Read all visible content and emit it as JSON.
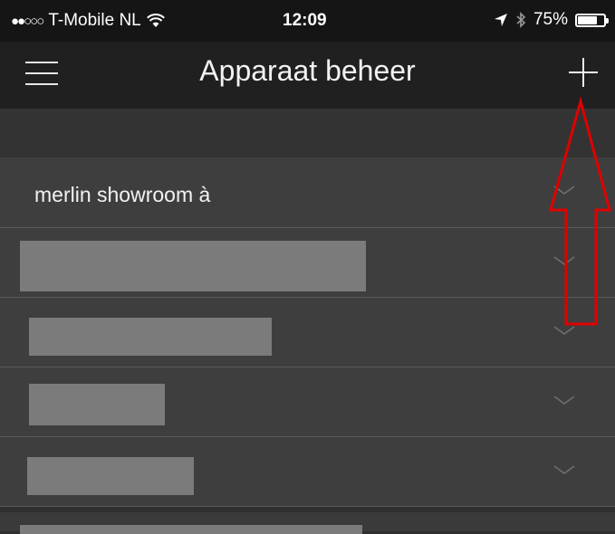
{
  "status_bar": {
    "signal": "●●○○○",
    "carrier": "T-Mobile NL",
    "time": "12:09",
    "battery": "75%",
    "battery_level": 0.75,
    "icons": [
      "wifi-icon",
      "location-arrow-icon",
      "bluetooth-icon",
      "battery-icon"
    ]
  },
  "nav": {
    "title": "Apparaat beheer",
    "menu_icon": "hamburger-menu-icon",
    "add_icon": "plus-icon"
  },
  "devices": [
    {
      "label": "merlin showroom à",
      "redacted": false
    },
    {
      "label": "",
      "redacted": true
    },
    {
      "label": "",
      "redacted": true
    },
    {
      "label": "",
      "redacted": true
    },
    {
      "label": "",
      "redacted": true
    }
  ],
  "colors": {
    "status_bar_bg": "#151515",
    "nav_bg": "#202020",
    "row_bg": "#3e3e3e",
    "redaction": "#7b7b7b",
    "annotation_arrow": "#e00000"
  }
}
